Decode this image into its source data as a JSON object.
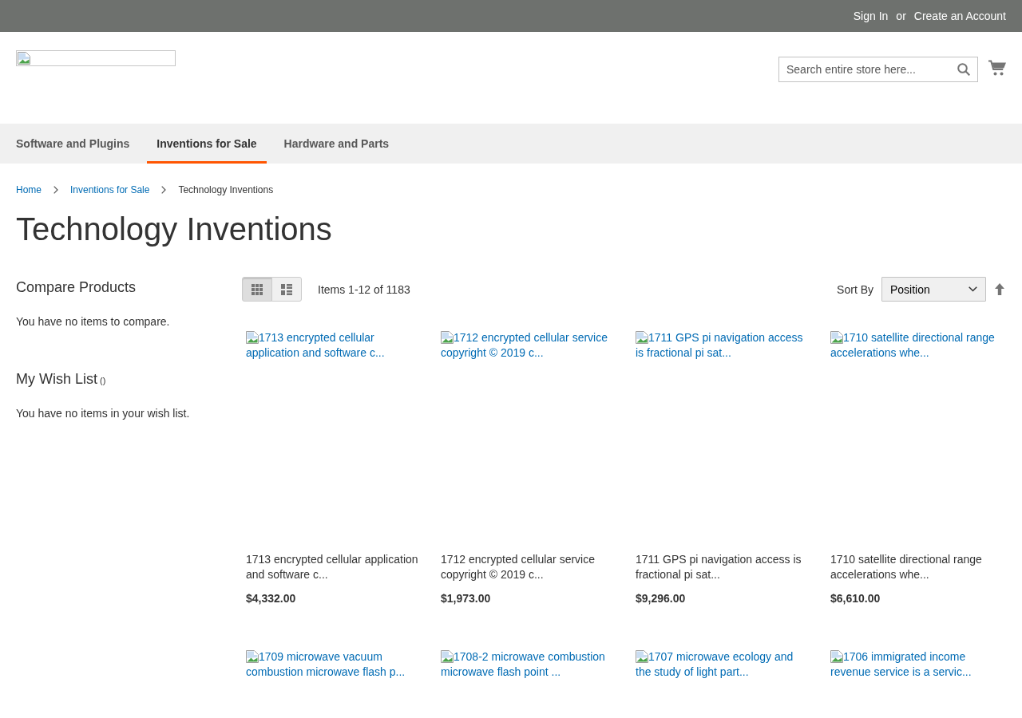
{
  "top_bar": {
    "sign_in": "Sign In",
    "separator": "or",
    "create_account": "Create an Account"
  },
  "header": {
    "search": {
      "placeholder": "Search entire store here..."
    }
  },
  "navigation": {
    "items": [
      {
        "label": "Software and Plugins",
        "selected": false
      },
      {
        "label": "Inventions for Sale",
        "selected": true
      },
      {
        "label": "Hardware and Parts",
        "selected": false
      }
    ]
  },
  "breadcrumbs": [
    {
      "label": "Home",
      "kind": "link"
    },
    {
      "label": "Inventions for Sale",
      "kind": "link"
    },
    {
      "label": "Technology Inventions",
      "kind": "current"
    }
  ],
  "page_title": "Technology Inventions",
  "sidebar": {
    "compare": {
      "title": "Compare Products",
      "message": "You have no items to compare."
    },
    "wishlist": {
      "title": "My Wish List",
      "counter": "()",
      "message": "You have no items in your wish list."
    }
  },
  "toolbar": {
    "view_modes": [
      {
        "kind": "grid",
        "selected": true
      },
      {
        "kind": "list",
        "selected": false
      }
    ],
    "amount": "Items 1-12 of 1183",
    "sort_label": "Sort By",
    "sort_value": "Position"
  },
  "products": [
    {
      "image_alt": "1713 encrypted cellular application and software c...",
      "name": "1713 encrypted cellular application and software c...",
      "price": "$4,332.00"
    },
    {
      "image_alt": "1712 encrypted cellular service copyright © 2019 c...",
      "name": "1712 encrypted cellular service copyright © 2019 c...",
      "price": "$1,973.00"
    },
    {
      "image_alt": "1711 GPS pi navigation access is fractional pi sat...",
      "name": "1711 GPS pi navigation access is fractional pi sat...",
      "price": "$9,296.00"
    },
    {
      "image_alt": "1710 satellite directional range accelerations whe...",
      "name": "1710 satellite directional range accelerations whe...",
      "price": "$6,610.00"
    },
    {
      "image_alt": "1709 microwave vacuum combustion microwave flash p..."
    },
    {
      "image_alt": "1708-2 microwave combustion microwave flash point ..."
    },
    {
      "image_alt": "1707 microwave ecology and the study of light part..."
    },
    {
      "image_alt": "1706 immigrated income revenue service is a servic..."
    }
  ]
}
